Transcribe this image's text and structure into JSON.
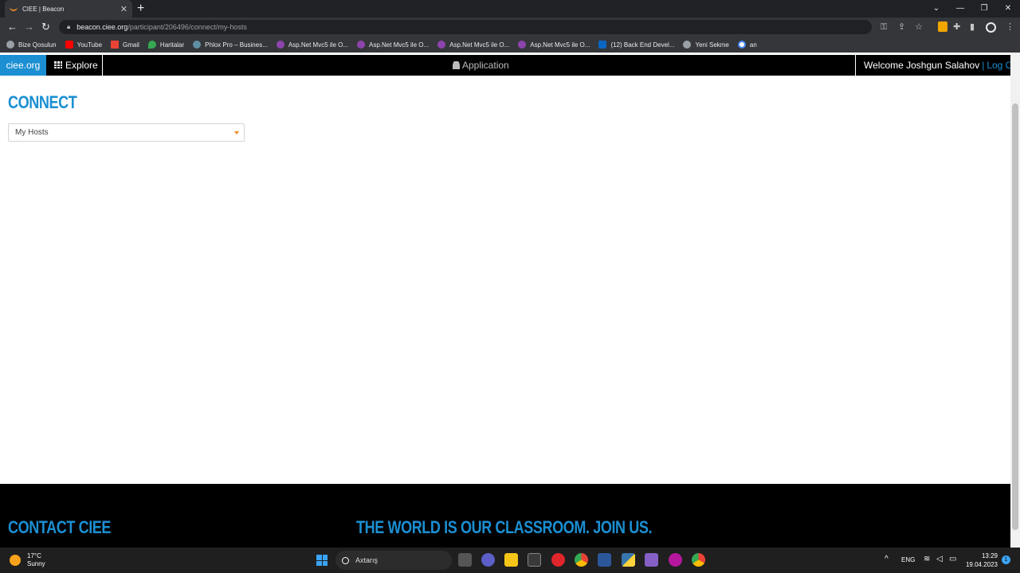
{
  "browser": {
    "tab_title": "CIEE | Beacon",
    "tab_close": "✕",
    "new_tab": "+",
    "url_host": "beacon.ciee.org",
    "url_path": "/participant/206496/connect/my-hosts",
    "window_controls": [
      "⌄",
      "—",
      "❐",
      "✕"
    ],
    "bookmarks": [
      {
        "label": "Bize Qosulun",
        "icon": "globe-icon"
      },
      {
        "label": "YouTube",
        "icon": "youtube-icon"
      },
      {
        "label": "Gmail",
        "icon": "gmail-icon"
      },
      {
        "label": "Haritalar",
        "icon": "maps-icon"
      },
      {
        "label": "Phlox Pro – Busines...",
        "icon": "phlox-icon"
      },
      {
        "label": "Asp.Net Mvc5 ile O...",
        "icon": "udemy-icon"
      },
      {
        "label": "Asp.Net Mvc5 ile O...",
        "icon": "udemy-icon"
      },
      {
        "label": "Asp.Net Mvc5 ile O...",
        "icon": "udemy-icon"
      },
      {
        "label": "Asp.Net Mvc5 ile O...",
        "icon": "udemy-icon"
      },
      {
        "label": "(12) Back End Devel...",
        "icon": "linkedin-icon"
      },
      {
        "label": "Yeni Sekme",
        "icon": "globe-icon"
      },
      {
        "label": "an",
        "icon": "google-icon"
      }
    ]
  },
  "site": {
    "brand": "ciee.org",
    "explore": "Explore",
    "application": "Application",
    "welcome": "Welcome Joshgun Salahov",
    "separator": "|",
    "logout": "Log Out",
    "heading": "CONNECT",
    "select_value": "My Hosts",
    "footer_contact": "CONTACT CIEE",
    "footer_slogan": "THE WORLD IS OUR CLASSROOM. JOIN US."
  },
  "taskbar": {
    "temperature": "17°C",
    "weather": "Sunny",
    "search": "Axtarış",
    "language": "ENG",
    "time": "13:29",
    "date": "19.04.2023",
    "notification_count": "1"
  },
  "colors": {
    "accent": "#1b8fd2",
    "caret": "#f08a24"
  }
}
